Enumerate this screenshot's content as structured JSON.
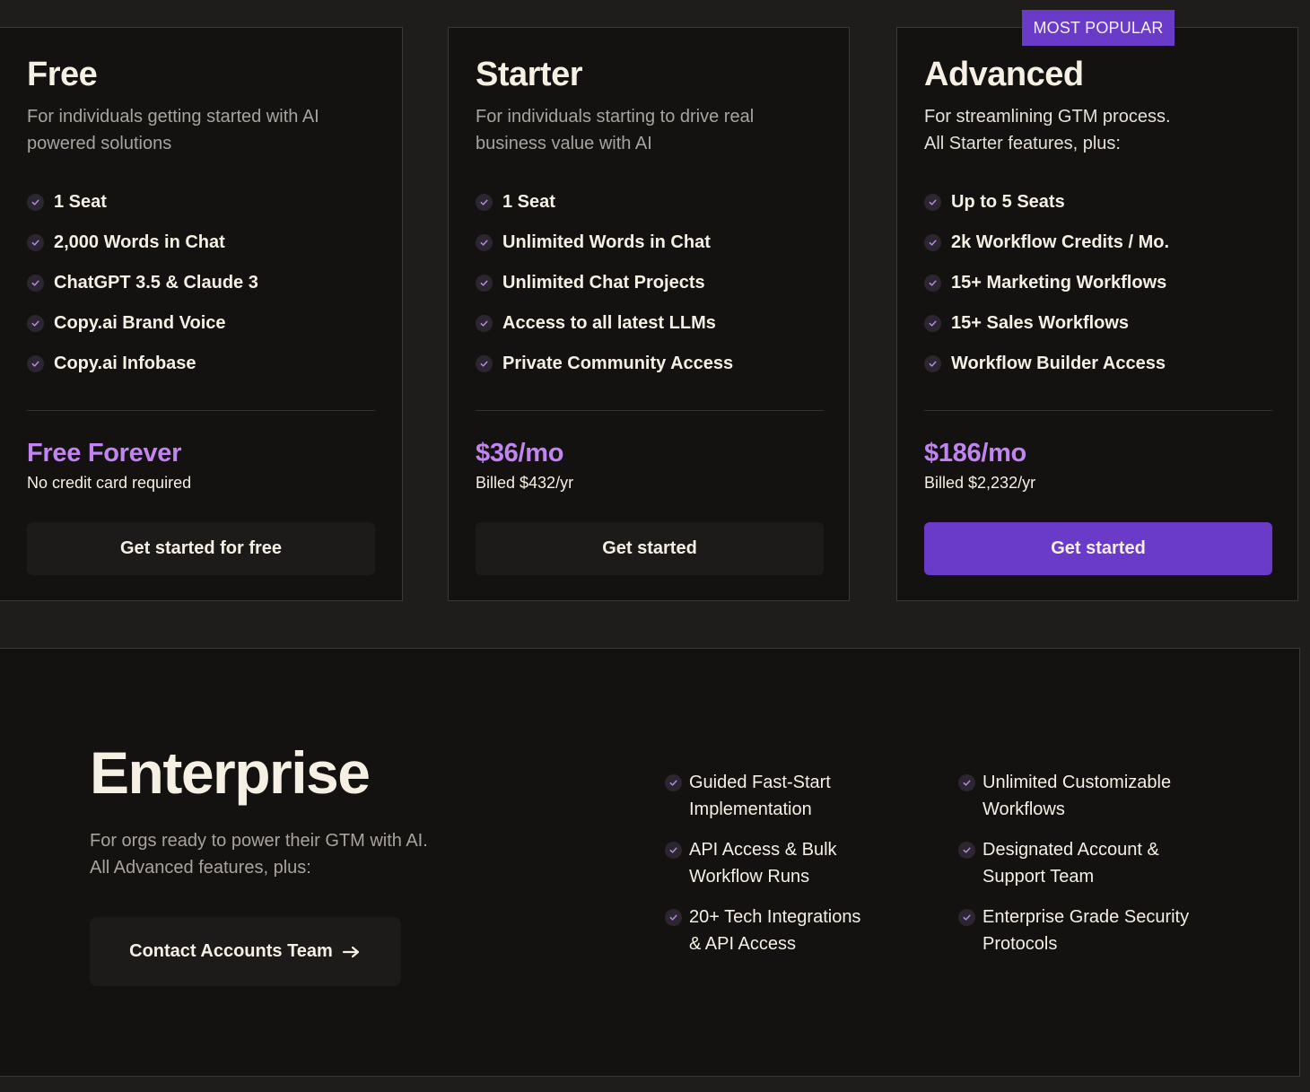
{
  "plans": [
    {
      "title": "Free",
      "description": [
        "For individuals getting started with AI",
        "powered solutions"
      ],
      "features": [
        "1 Seat",
        "2,000 Words in Chat",
        "ChatGPT 3.5 & Claude 3",
        "Copy.ai Brand Voice",
        "Copy.ai Infobase"
      ],
      "price": "Free Forever",
      "billing": "No credit card required",
      "cta": "Get started for free"
    },
    {
      "title": "Starter",
      "description": [
        "For individuals starting to drive real",
        "business value with AI"
      ],
      "features": [
        "1 Seat",
        "Unlimited Words in Chat",
        "Unlimited Chat Projects",
        "Access to all latest LLMs",
        "Private Community Access"
      ],
      "price": "$36/mo",
      "billing": "Billed $432/yr",
      "cta": "Get started"
    },
    {
      "title": "Advanced",
      "badge": "MOST POPULAR",
      "description": [
        "For streamlining GTM process.",
        "All Starter features, plus:"
      ],
      "features": [
        "Up to 5 Seats",
        "2k Workflow Credits / Mo.",
        "15+ Marketing Workflows",
        "15+ Sales Workflows",
        "Workflow Builder Access"
      ],
      "price": "$186/mo",
      "billing": "Billed $2,232/yr",
      "cta": "Get started"
    }
  ],
  "enterprise": {
    "title": "Enterprise",
    "description": [
      "For orgs ready to power their GTM with AI.",
      "All Advanced features, plus:"
    ],
    "cta": "Contact Accounts Team",
    "features_col1": [
      [
        "Guided Fast-Start",
        "Implementation"
      ],
      [
        "API Access & Bulk",
        "Workflow Runs"
      ],
      [
        "20+ Tech Integrations",
        "& API Access"
      ]
    ],
    "features_col2": [
      [
        "Unlimited Customizable",
        "Workflows"
      ],
      [
        "Designated Account &",
        "Support Team"
      ],
      [
        "Enterprise Grade Security",
        "Protocols"
      ]
    ]
  },
  "colors": {
    "accent": "#6a3bc9",
    "price": "#c285f0",
    "background": "#1e1d1c",
    "card": "#131211"
  },
  "icons": {
    "feature_check": "check-circle-icon",
    "cta_arrow": "arrow-right-icon"
  }
}
